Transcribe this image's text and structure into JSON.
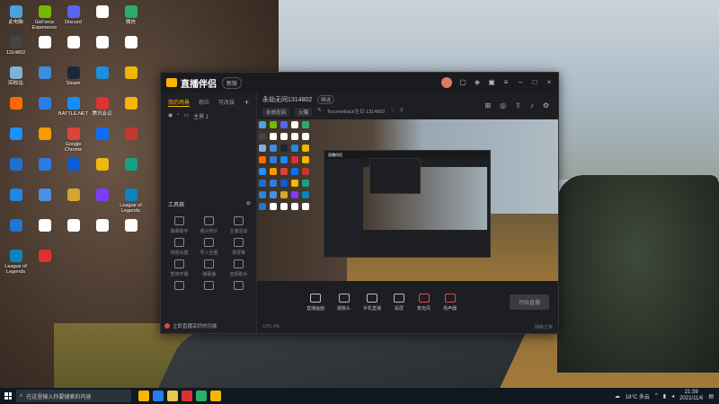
{
  "desktop": {
    "icons": [
      {
        "label": "此电脑",
        "color": "#4aa3df"
      },
      {
        "label": "GeForce Experience",
        "color": "#76b900"
      },
      {
        "label": "Discord",
        "color": "#5865f2"
      },
      {
        "label": "",
        "color": "#ffffff"
      },
      {
        "label": "微信",
        "color": "#2aae67"
      },
      {
        "label": "1314802",
        "color": "#444"
      },
      {
        "label": "",
        "color": "#ffffff"
      },
      {
        "label": "",
        "color": "#ffffff"
      },
      {
        "label": "",
        "color": "#ffffff"
      },
      {
        "label": "",
        "color": "#ffffff"
      },
      {
        "label": "回收站",
        "color": "#7fb3d5"
      },
      {
        "label": "",
        "color": "#3b8ee0"
      },
      {
        "label": "Steam",
        "color": "#1b2838"
      },
      {
        "label": "",
        "color": "#1b8fe0"
      },
      {
        "label": "",
        "color": "#f2b600"
      },
      {
        "label": "",
        "color": "#ff6a00"
      },
      {
        "label": "",
        "color": "#2a7de1"
      },
      {
        "label": "BATTLE.NET",
        "color": "#148eff"
      },
      {
        "label": "腾讯会议",
        "color": "#e03131"
      },
      {
        "label": "",
        "color": "#f7b500"
      },
      {
        "label": "",
        "color": "#1e90ff"
      },
      {
        "label": "",
        "color": "#f79a00"
      },
      {
        "label": "Google Chrome",
        "color": "#db4437"
      },
      {
        "label": "",
        "color": "#0d6efd"
      },
      {
        "label": "",
        "color": "#c0392b"
      },
      {
        "label": "",
        "color": "#1f6fd1"
      },
      {
        "label": "",
        "color": "#2b7be4"
      },
      {
        "label": "",
        "color": "#0b5ed7"
      },
      {
        "label": "",
        "color": "#f0b90b"
      },
      {
        "label": "",
        "color": "#16a085"
      },
      {
        "label": "",
        "color": "#1e88e5"
      },
      {
        "label": "",
        "color": "#4a90e2"
      },
      {
        "label": "",
        "color": "#d4a72c"
      },
      {
        "label": "",
        "color": "#7d3cff"
      },
      {
        "label": "League of Legends",
        "color": "#0a84c1"
      },
      {
        "label": "",
        "color": "#1f77d0"
      },
      {
        "label": "",
        "color": "#ffffff"
      },
      {
        "label": "",
        "color": "#ffffff"
      },
      {
        "label": "",
        "color": "#ffffff"
      },
      {
        "label": "",
        "color": "#ffffff"
      },
      {
        "label": "League of Legends",
        "color": "#0a84c1"
      },
      {
        "label": "",
        "color": "#e03131"
      }
    ]
  },
  "app": {
    "name": "直播伴侣",
    "badge": "新版",
    "sidebar": {
      "tabs": [
        "我的场景",
        "观众",
        "可改装"
      ],
      "scene_label": "主界 1",
      "tools_header": "工具箱",
      "tools": [
        "弹幕助手",
        "观众统计",
        "主播活动",
        "场景设置",
        "导入全图",
        "录屏等",
        "暂停开播",
        "弹幕播",
        "音频助手",
        "",
        "",
        ""
      ],
      "promo": "立即直播享好的功能"
    },
    "main": {
      "room_title": "永劫无间1314802",
      "room_tag": "精选",
      "meta_btn1": "永劫无间",
      "meta_btn2": "火爆",
      "meta_text": "Tocomeback生日 1314802",
      "likes": "0",
      "controls": [
        "直播画面",
        "摄像头",
        "手机直播",
        "投屏",
        "麦克风",
        "扬声器"
      ],
      "go_live": "开始直播",
      "status_left": "CPU 0%",
      "status_right": "网络正常"
    }
  },
  "taskbar": {
    "search_placeholder": "在这里输入你要搜索的内容",
    "weather": "18°C 多云",
    "time": "21:39",
    "date": "2021/11/6",
    "app_colors": [
      "#f7b500",
      "#2b7be4",
      "#e7c64a",
      "#e03131",
      "#2aae67",
      "#f7b500"
    ]
  },
  "colors": {
    "accent": "#f7b500",
    "live_red": "#e04848",
    "taskbar": "#101820"
  }
}
